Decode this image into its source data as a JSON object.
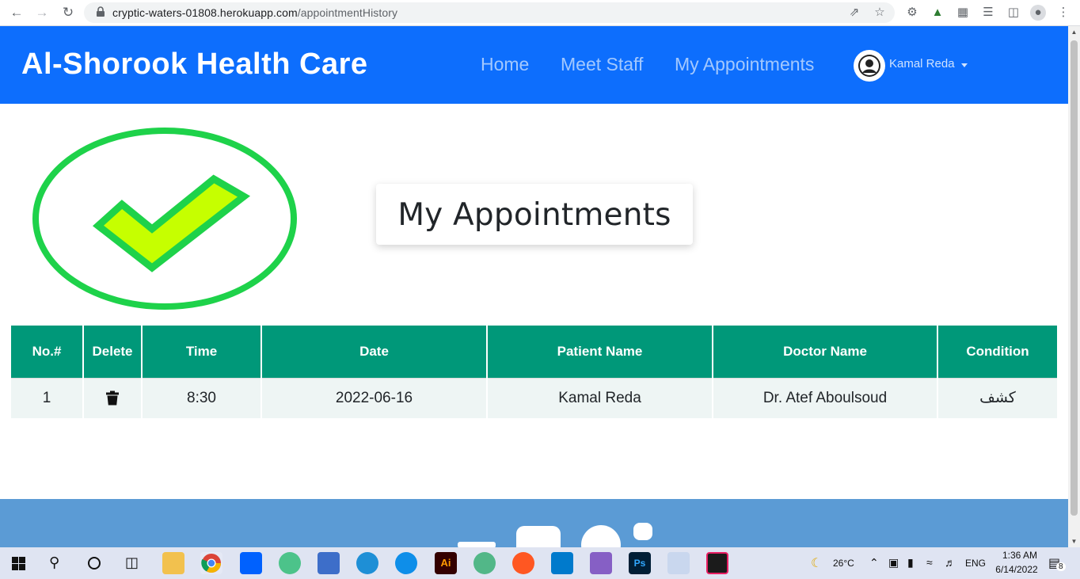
{
  "browser": {
    "url_host": "cryptic-waters-01808.herokuapp.com",
    "url_path": "/appointmentHistory"
  },
  "navbar": {
    "brand": "Al-Shorook Health Care",
    "links": [
      "Home",
      "Meet Staff",
      "My Appointments"
    ],
    "user_name": "Kamal Reda"
  },
  "page": {
    "title": "My Appointments"
  },
  "table": {
    "headers": [
      "No.#",
      "Delete",
      "Time",
      "Date",
      "Patient Name",
      "Doctor Name",
      "Condition"
    ],
    "rows": [
      {
        "no": "1",
        "time": "8:30",
        "date": "2022-06-16",
        "patient": "Kamal Reda",
        "doctor": "Dr. Atef Aboulsoud",
        "condition": "كشف"
      }
    ]
  },
  "taskbar": {
    "weather": "26°C",
    "language": "ENG",
    "time": "1:36 AM",
    "date": "6/14/2022",
    "notification_count": "8"
  },
  "colors": {
    "navbar": "#0d6efd",
    "table_header": "#009879",
    "footer": "#5b9bd5",
    "check_ring": "#1ed24a",
    "check_fill": "#c6ff00"
  }
}
